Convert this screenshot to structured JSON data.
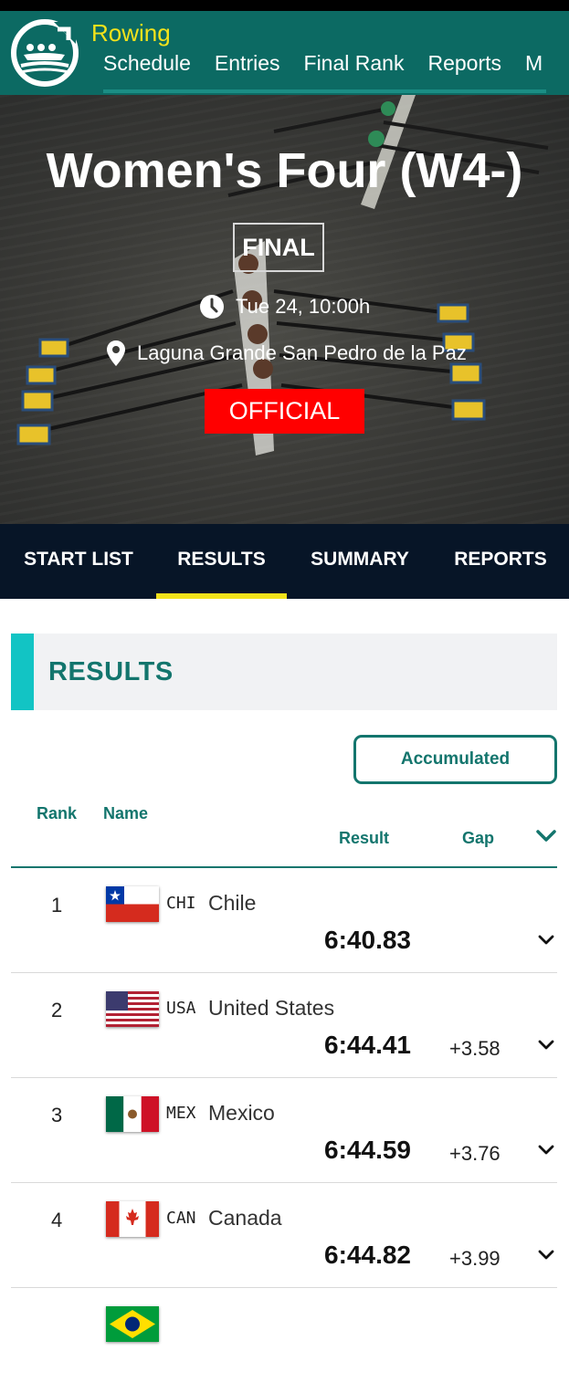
{
  "header": {
    "sport": "Rowing",
    "nav": [
      "Schedule",
      "Entries",
      "Final Rank",
      "Reports",
      "M"
    ]
  },
  "event": {
    "title": "Women's Four (W4-)",
    "phase": "FINAL",
    "datetime": "Tue 24, 10:00h",
    "venue": "Laguna Grande San Pedro de la Paz",
    "status": "OFFICIAL"
  },
  "tabs": [
    "START LIST",
    "RESULTS",
    "SUMMARY",
    "REPORTS"
  ],
  "active_tab": "RESULTS",
  "section": {
    "title": "RESULTS",
    "toggle_label": "Accumulated"
  },
  "columns": {
    "rank": "Rank",
    "name": "Name",
    "result": "Result",
    "gap": "Gap"
  },
  "results": [
    {
      "rank": "1",
      "code": "CHI",
      "country": "Chile",
      "result": "6:40.83",
      "gap": ""
    },
    {
      "rank": "2",
      "code": "USA",
      "country": "United States",
      "result": "6:44.41",
      "gap": "+3.58"
    },
    {
      "rank": "3",
      "code": "MEX",
      "country": "Mexico",
      "result": "6:44.59",
      "gap": "+3.76"
    },
    {
      "rank": "4",
      "code": "CAN",
      "country": "Canada",
      "result": "6:44.82",
      "gap": "+3.99"
    }
  ],
  "colors": {
    "header": "#0c6a63",
    "accent_yellow": "#f3e21b",
    "teal_text": "#13756d",
    "tabs_bg": "#071527",
    "official_red": "#ff0000",
    "section_bar": "#12c4c4"
  }
}
